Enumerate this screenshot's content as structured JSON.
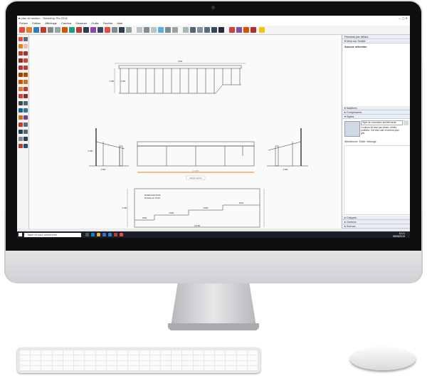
{
  "window": {
    "title": "plan de section - SketchUp Pro 2018"
  },
  "menu": [
    "Fichier",
    "Edition",
    "Affichage",
    "Caméra",
    "Dessiner",
    "Outils",
    "Fenêtre",
    "Aide"
  ],
  "toolbar": {
    "layer_select": "Layer0"
  },
  "tray": {
    "header": "Panneau par défaut",
    "entity_info": "Infos sur l'entité",
    "selection_text": "Aucune sélection",
    "sections": [
      "Matières",
      "Composants",
      "Styles"
    ],
    "style_name": "Style de conception architecturale",
    "style_desc": "Couleurs de face par défaut. Arêtes profilées. Ciel bleu clair et arrière-plan gris.",
    "style_tabs": [
      "Sélectionner",
      "Éditer",
      "Mélange"
    ],
    "bottom_sections": [
      "Calques",
      "Ombres",
      "Scènes"
    ]
  },
  "drawing": {
    "dims_top": [
      "1430",
      "2780",
      "2780"
    ],
    "dims_mid": [
      "14000",
      "2780",
      "2780",
      "2780"
    ],
    "label_mid": "Clôture section",
    "dims_bottom": [
      "1650",
      "3600",
      "3600",
      "3600",
      "14000",
      "2780"
    ],
    "annot": [
      "BARDAGE BOIS",
      "ÉCHELLE 1/100"
    ]
  },
  "taskbar": {
    "search_placeholder": "Taper ici pour rechercher",
    "time": "14:21",
    "date": "08/05/2019"
  }
}
